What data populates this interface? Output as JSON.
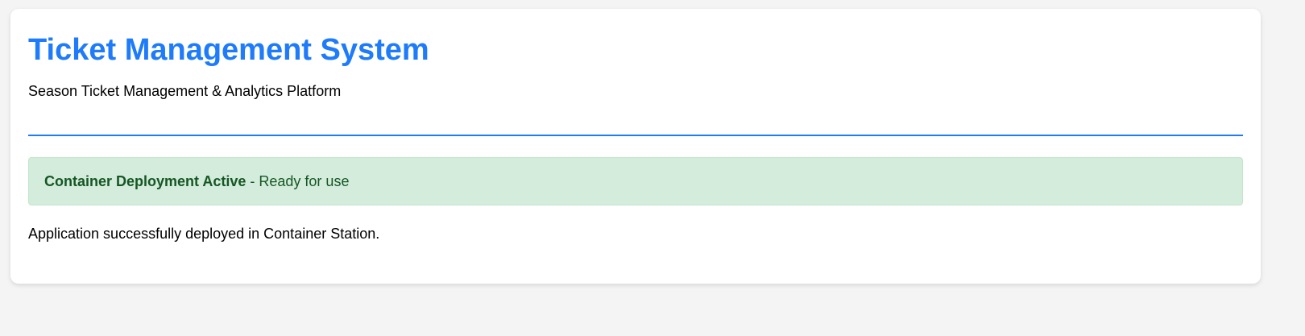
{
  "header": {
    "title": "Ticket Management System",
    "subtitle": "Season Ticket Management & Analytics Platform"
  },
  "alert": {
    "strong": "Container Deployment Active",
    "separator": " - ",
    "text": "Ready for use"
  },
  "message": "Application successfully deployed in Container Station.",
  "colors": {
    "accent": "#1e7bfa",
    "success_bg": "#d4ecdb",
    "success_text": "#155724"
  }
}
